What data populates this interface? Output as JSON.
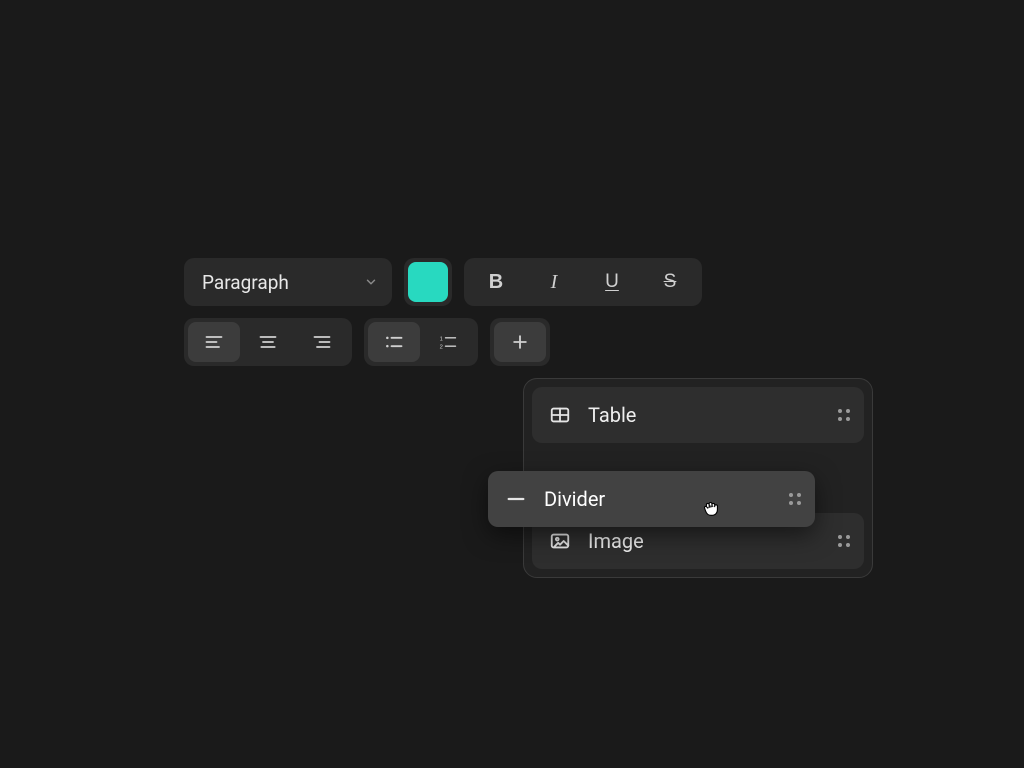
{
  "toolbar": {
    "block_type": "Paragraph",
    "accent_color": "#28d9c0",
    "format": {
      "bold": "B",
      "italic": "I",
      "underline": "U",
      "strike": "S"
    }
  },
  "insert_menu": {
    "items": [
      {
        "icon": "table-icon",
        "label": "Table"
      },
      {
        "icon": "divider-icon",
        "label": "Divider"
      },
      {
        "icon": "image-icon",
        "label": "Image"
      }
    ],
    "dragging_index": 1
  }
}
